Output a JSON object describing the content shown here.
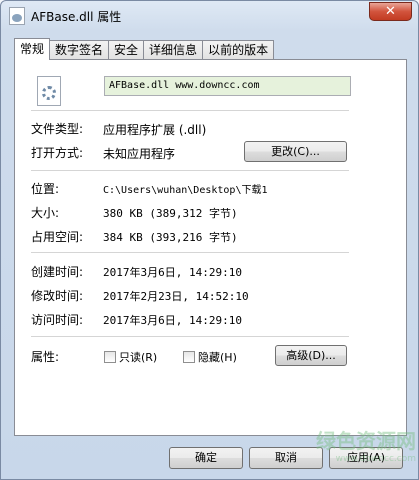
{
  "window": {
    "title": "AFBase.dll 属性",
    "close_label": "✕"
  },
  "tabs": [
    {
      "label": "常规",
      "active": true
    },
    {
      "label": "数字签名",
      "active": false
    },
    {
      "label": "安全",
      "active": false
    },
    {
      "label": "详细信息",
      "active": false
    },
    {
      "label": "以前的版本",
      "active": false
    }
  ],
  "general": {
    "file_name": "AFBase.dll  www.downcc.com",
    "file_type_label": "文件类型:",
    "file_type_value": "应用程序扩展 (.dll)",
    "opens_with_label": "打开方式:",
    "opens_with_value": "未知应用程序",
    "change_button": "更改(C)...",
    "location_label": "位置:",
    "location_value": "C:\\Users\\wuhan\\Desktop\\下载1",
    "size_label": "大小:",
    "size_value": "380 KB (389,312 字节)",
    "size_on_disk_label": "占用空间:",
    "size_on_disk_value": "384 KB (393,216 字节)",
    "created_label": "创建时间:",
    "created_value": "2017年3月6日, 14:29:10",
    "modified_label": "修改时间:",
    "modified_value": "2017年2月23日, 14:52:10",
    "accessed_label": "访问时间:",
    "accessed_value": "2017年3月6日, 14:29:10",
    "attributes_label": "属性:",
    "readonly_label": "只读(R)",
    "readonly_checked": false,
    "hidden_label": "隐藏(H)",
    "hidden_checked": false,
    "advanced_button": "高级(D)..."
  },
  "footer": {
    "ok_button": "确定",
    "cancel_button": "取消",
    "apply_button": "应用(A)"
  },
  "watermark": {
    "text": "绿色资源网",
    "url": "www.downcc.com"
  },
  "colors": {
    "name_field_bg": "#e6f2dc",
    "close_button": "#c23b22"
  },
  "icons": {
    "file": "dll-file-icon",
    "close": "close-icon"
  }
}
